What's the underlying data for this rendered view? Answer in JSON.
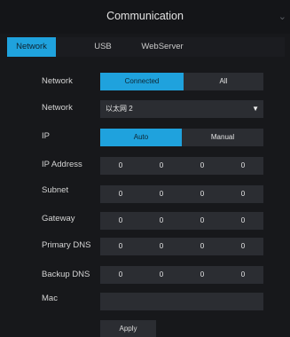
{
  "window": {
    "title": "Communication",
    "close_glyph": "⌄"
  },
  "tabs": [
    {
      "label": "Network",
      "active": true
    },
    {
      "label": "USB",
      "active": false
    },
    {
      "label": "WebServer",
      "active": false
    }
  ],
  "network_status": {
    "label": "Network",
    "options": [
      "Connected",
      "All"
    ],
    "selected": "Connected"
  },
  "network_adapter": {
    "label": "Network",
    "value": "以太网 2"
  },
  "ip_mode": {
    "label": "IP",
    "options": [
      "Auto",
      "Manual"
    ],
    "selected": "Auto"
  },
  "fields": [
    {
      "label": "IP Address",
      "octets": [
        "0",
        "0",
        "0",
        "0"
      ]
    },
    {
      "label": "Subnet",
      "octets": [
        "0",
        "0",
        "0",
        "0"
      ]
    },
    {
      "label": "Gateway",
      "octets": [
        "0",
        "0",
        "0",
        "0"
      ]
    },
    {
      "label": "Primary DNS",
      "octets": [
        "0",
        "0",
        "0",
        "0"
      ]
    },
    {
      "label": "Backup DNS",
      "octets": [
        "0",
        "0",
        "0",
        "0"
      ]
    }
  ],
  "mac": {
    "label": "Mac",
    "value": ""
  },
  "apply_label": "Apply",
  "colors": {
    "accent": "#1fa2dd",
    "background": "#17181b",
    "field": "#2b2d32"
  }
}
